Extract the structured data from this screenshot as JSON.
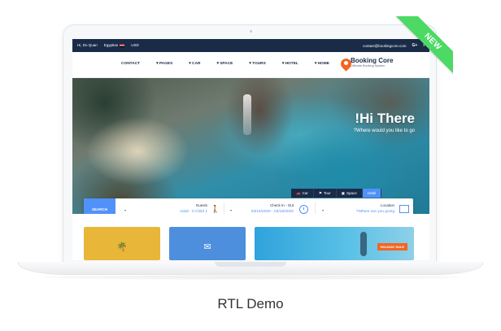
{
  "topbar": {
    "user": "Hi, Do Quan",
    "language": "Egyptian",
    "currency": "USD",
    "email": "contact@bookingcore.com",
    "social": [
      "G+",
      "f"
    ]
  },
  "nav": {
    "items": [
      "CONTACT",
      "PAGES",
      "CAR",
      "SPACE",
      "TOURS",
      "HOTEL",
      "HOME"
    ]
  },
  "logo": {
    "brand": "Booking Core",
    "tagline": "Ultimate Booking System"
  },
  "hero": {
    "title": "!Hi There",
    "subtitle": "?Where would you like to go"
  },
  "tabs": [
    {
      "label": "Car",
      "icon": "car-icon"
    },
    {
      "label": "Tour",
      "icon": "flag-icon"
    },
    {
      "label": "Space",
      "icon": "building-icon"
    },
    {
      "label": "Hotel",
      "icon": "bed-icon",
      "active": true
    }
  ],
  "search": {
    "button": "SEARCH",
    "guests_label": "Guests",
    "guests_value": "Adult - 0 Child 1",
    "dates_label": "Check In - Out",
    "dates_value": "03/16/2020 - 03/18/2020",
    "location_label": "Location",
    "location_value": "?Where are you going"
  },
  "cards": {
    "sale_badge": "HOLIDAY SALE"
  },
  "ribbon": "NEW",
  "caption": "RTL Demo",
  "colors": {
    "navy": "#1a2b48",
    "accent": "#5191fa",
    "ribbon": "#4cd964",
    "brand_orange": "#f26522"
  }
}
